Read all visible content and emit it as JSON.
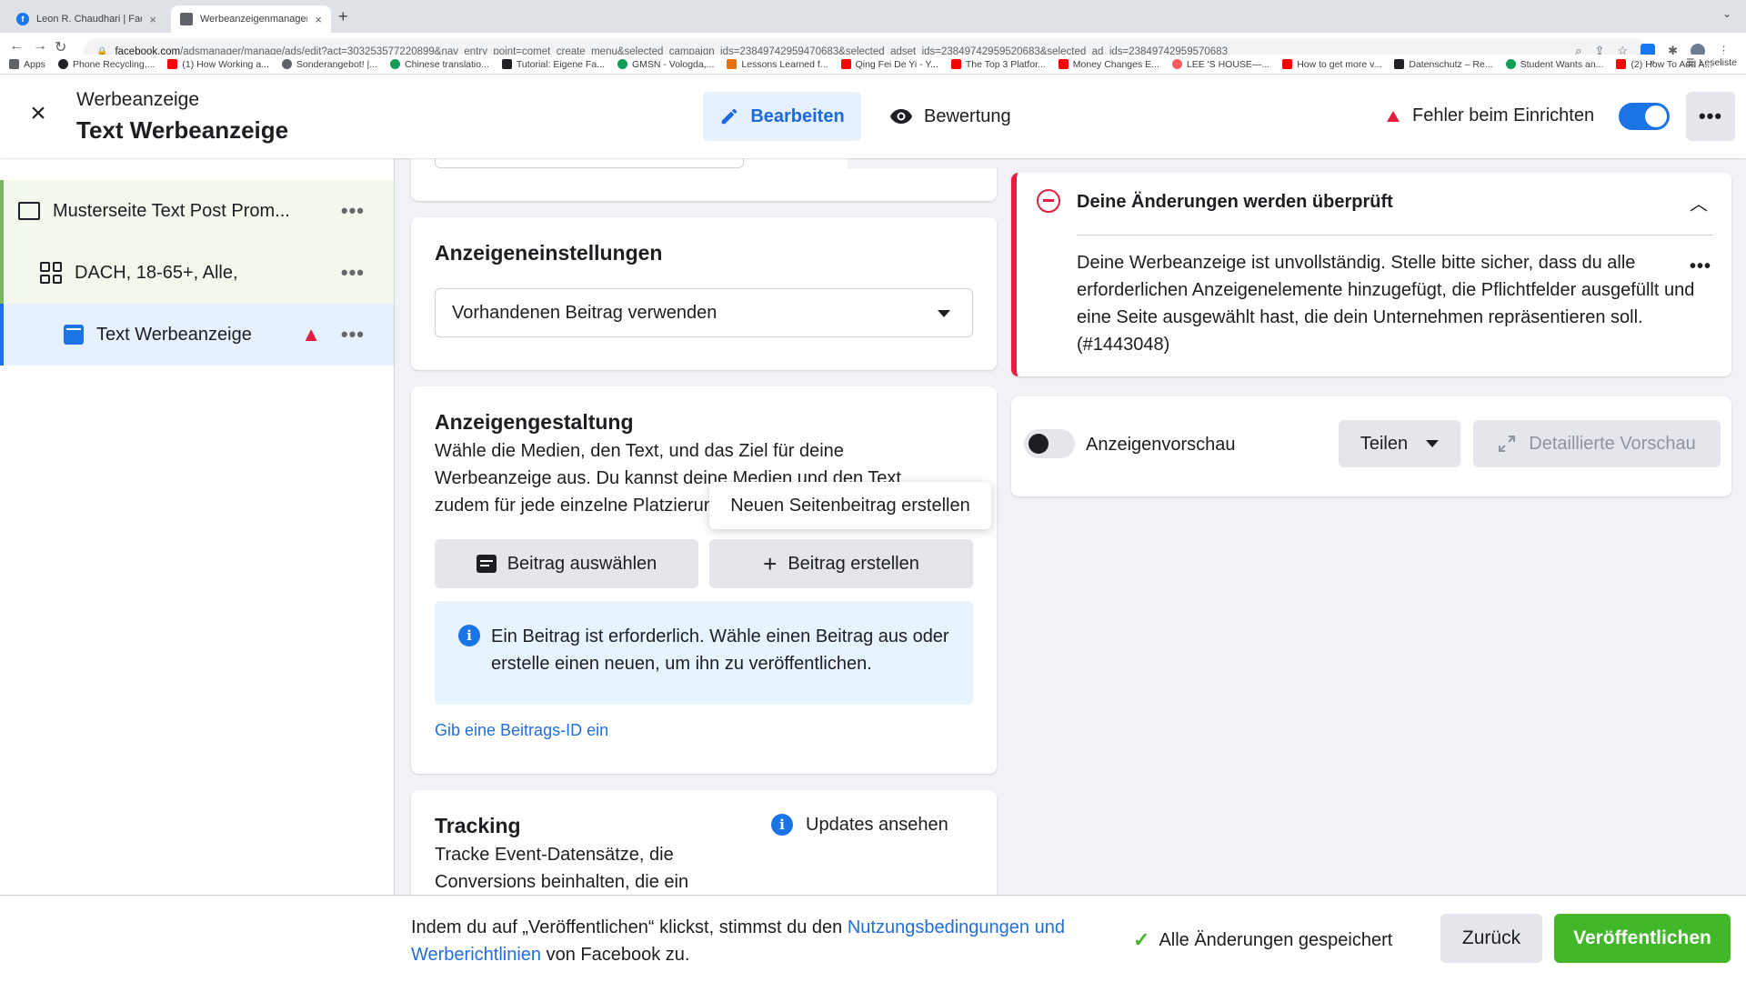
{
  "browser": {
    "tabs": [
      {
        "title": "Leon R. Chaudhari | Facebook",
        "active": false
      },
      {
        "title": "Werbeanzeigenmanager - Wer",
        "active": true
      }
    ],
    "url_domain": "facebook.com",
    "url_path": "/adsmanager/manage/ads/edit?act=303253577220899&nav_entry_point=comet_create_menu&selected_campaign_ids=23849742959470683&selected_adset_ids=23849742959520683&selected_ad_ids=23849742959570683",
    "bookmarks": [
      {
        "label": "Apps",
        "color": "#5f6368"
      },
      {
        "label": "Phone Recycling,...",
        "color": "#202124"
      },
      {
        "label": "(1) How Working a...",
        "color": "#ff0000"
      },
      {
        "label": "Sonderangebot! |...",
        "color": "#5f6368"
      },
      {
        "label": "Chinese translatio...",
        "color": "#0f9d58"
      },
      {
        "label": "Tutorial: Eigene Fa...",
        "color": "#202124"
      },
      {
        "label": "GMSN - Vologda,...",
        "color": "#0f9d58"
      },
      {
        "label": "Lessons Learned f...",
        "color": "#e8710a"
      },
      {
        "label": "Qing Fei De Yi - Y...",
        "color": "#ff0000"
      },
      {
        "label": "The Top 3 Platfor...",
        "color": "#ff0000"
      },
      {
        "label": "Money Changes E...",
        "color": "#ff0000"
      },
      {
        "label": "LEE 'S HOUSE—...",
        "color": "#ff5a5f"
      },
      {
        "label": "How to get more v...",
        "color": "#ff0000"
      },
      {
        "label": "Datenschutz – Re...",
        "color": "#202124"
      },
      {
        "label": "Student Wants an...",
        "color": "#0f9d58"
      },
      {
        "label": "(2) How To Add A...",
        "color": "#ff0000"
      }
    ],
    "reading_list": "Leseliste"
  },
  "header": {
    "type": "Werbeanzeige",
    "name": "Text Werbeanzeige",
    "edit_label": "Bearbeiten",
    "review_label": "Bewertung",
    "error_label": "Fehler beim Einrichten",
    "toggle_on": true
  },
  "sidebar": {
    "campaign": "Musterseite Text Post Prom...",
    "adset": "DACH, 18-65+, Alle,",
    "ad": "Text Werbeanzeige"
  },
  "settings": {
    "title": "Anzeigeneinstellungen",
    "selected": "Vorhandenen Beitrag verwenden"
  },
  "design": {
    "title": "Anzeigengestaltung",
    "description": "Wähle die Medien, den Text, und das Ziel für deine Werbeanzeige aus. Du kannst deine Medien und den Text zudem für jede einzelne Platzierung",
    "select_button": "Beitrag auswählen",
    "create_button": "Beitrag erstellen",
    "tooltip": "Neuen Seitenbeitrag erstellen",
    "info": "Ein Beitrag ist erforderlich. Wähle einen Beitrag aus oder erstelle einen neuen, um ihn zu veröffentlichen.",
    "post_id_link": "Gib eine Beitrags-ID ein"
  },
  "tracking": {
    "title": "Tracking",
    "description": "Tracke Event-Datensätze, die Conversions beinhalten, die ein",
    "updates": "Updates ansehen"
  },
  "review_card": {
    "title": "Deine Änderungen werden überprüft",
    "text": "Deine Werbeanzeige ist unvollständig. Stelle bitte sicher, dass du alle erforderlichen Anzeigenelemente hinzugefügt, die Pflichtfelder ausgefüllt und eine Seite ausgewählt hast, die dein Unternehmen repräsentieren soll. (#1443048)"
  },
  "preview": {
    "label": "Anzeigenvorschau",
    "share": "Teilen",
    "detail": "Detaillierte Vorschau",
    "toggle_on": false
  },
  "footer": {
    "text_before": "Indem du auf „Veröffentlichen“ klickst, stimmst du den ",
    "link": "Nutzungsbedingungen und Werberichtlinien",
    "text_after": " von Facebook zu.",
    "saved": "Alle Änderungen gespeichert",
    "back": "Zurück",
    "publish": "Veröffentlichen"
  },
  "colors": {
    "accent": "#1b74e4",
    "error": "#e41e3f",
    "publish": "#42b72a"
  }
}
